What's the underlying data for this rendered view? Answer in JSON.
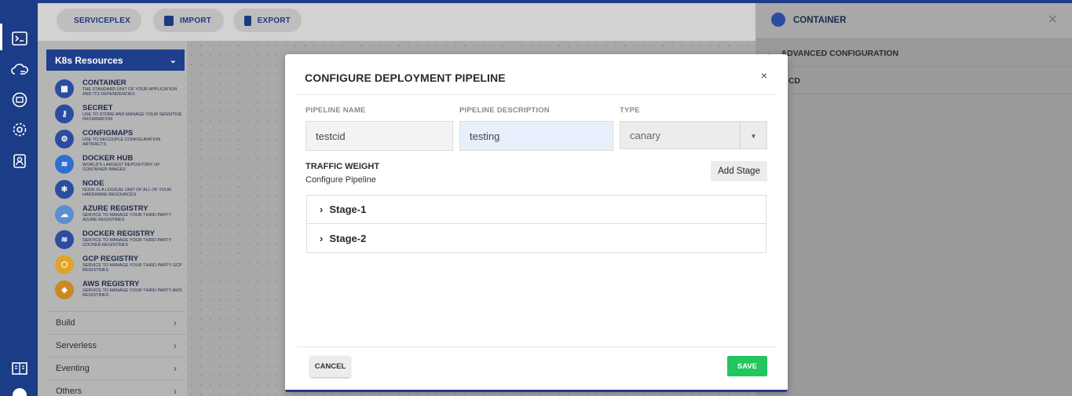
{
  "toolbar": {
    "buttons": [
      {
        "label": "SERVICEPLEX",
        "icon": "serviceplex-icon"
      },
      {
        "label": "IMPORT",
        "icon": "import-icon"
      },
      {
        "label": "EXPORT",
        "icon": "export-icon"
      }
    ]
  },
  "rail": {
    "icons": [
      "terminal-icon",
      "cloud-icon",
      "registry-icon",
      "gear-icon",
      "user-icon",
      "book-icon",
      "help-icon"
    ]
  },
  "resources": {
    "header": "K8s Resources",
    "items": [
      {
        "title": "CONTAINER",
        "desc": "THE STANDARD UNIT OF YOUR APPLICATION AND ITS DEPENDENCIES",
        "icon": "container-icon"
      },
      {
        "title": "SECRET",
        "desc": "USE TO STORE AND MANAGE YOUR SENSITIVE INFORMATION",
        "icon": "key-icon"
      },
      {
        "title": "CONFIGMAPS",
        "desc": "USE TO DECOUPLE CONFIGURATION ARTIFACTS",
        "icon": "configmap-icon"
      },
      {
        "title": "DOCKER HUB",
        "desc": "WORLD'S LARGEST REPOSITORY OF CONTAINER IMAGES",
        "icon": "docker-icon"
      },
      {
        "title": "NODE",
        "desc": "NODE IS A LOGICAL UNIT OF ALL OF YOUR HARDWARE RESOURCES",
        "icon": "node-icon"
      },
      {
        "title": "AZURE REGISTRY",
        "desc": "SERVICE TO MANAGE YOUR THIRD PARTY AZURE REGISTRIES",
        "icon": "azure-icon"
      },
      {
        "title": "DOCKER REGISTRY",
        "desc": "SERVICE TO MANAGE YOUR THIRD PARTY DOCKER REGISTRIES",
        "icon": "docker-registry-icon"
      },
      {
        "title": "GCP REGISTRY",
        "desc": "SERVICE TO MANAGE YOUR THIRD PARTY GCP REGISTRIES",
        "icon": "gcp-icon"
      },
      {
        "title": "AWS REGISTRY",
        "desc": "SERVICE TO MANAGE YOUR THIRD PARTY AWS REGISTRIES",
        "icon": "aws-icon"
      }
    ],
    "sections": [
      "Build",
      "Serverless",
      "Eventing",
      "Others"
    ]
  },
  "right_panel": {
    "title": "CONTAINER",
    "rows": [
      "ADVANCED CONFIGURATION",
      "/ CD"
    ]
  },
  "modal": {
    "title": "CONFIGURE DEPLOYMENT PIPELINE",
    "close": "×",
    "fields": {
      "name_label": "PIPELINE NAME",
      "name_value": "testcid",
      "desc_label": "PIPELINE DESCRIPTION",
      "desc_value": "testing",
      "type_label": "TYPE",
      "type_value": "canary"
    },
    "traffic_title": "TRAFFIC WEIGHT",
    "traffic_sub": "Configure Pipeline",
    "add_stage": "Add Stage",
    "stages": [
      "Stage-1",
      "Stage-2"
    ],
    "cancel": "CANCEL",
    "save": "SAVE"
  },
  "colors": {
    "brand": "#1f3c88",
    "save": "#22c55e"
  }
}
